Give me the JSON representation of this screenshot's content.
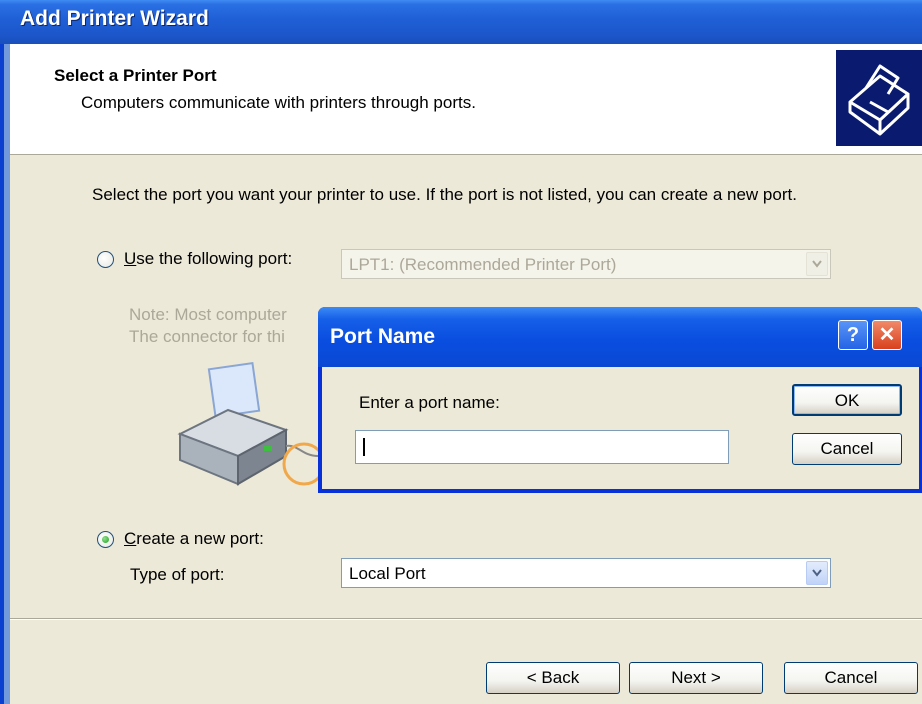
{
  "wizard": {
    "title": "Add Printer Wizard",
    "header_title": "Select a Printer Port",
    "header_subtitle": "Computers communicate with printers through ports.",
    "intro": "Select the port you want your printer to use.  If the port is not listed, you can create a new port.",
    "use_port_label": "Use the following port:",
    "use_port_value": "LPT1: (Recommended Printer Port)",
    "note_line1": "Note: Most computer",
    "note_line2": "The connector for thi",
    "create_port_label": "Create a new port:",
    "type_of_port_label": "Type of port:",
    "type_of_port_value": "Local Port",
    "back_label": "< Back",
    "next_label": "Next >",
    "cancel_label": "Cancel"
  },
  "dialog": {
    "title": "Port Name",
    "prompt": "Enter a port name:",
    "input_value": "",
    "ok_label": "OK",
    "cancel_label": "Cancel",
    "help_glyph": "?",
    "close_glyph": "✕"
  },
  "colors": {
    "accent": "#0a4ee0",
    "close": "#e2442b"
  },
  "icons": [
    "printer-setup-icon",
    "printer-illustration-icon",
    "chevron-down-icon",
    "help-icon",
    "close-icon"
  ]
}
